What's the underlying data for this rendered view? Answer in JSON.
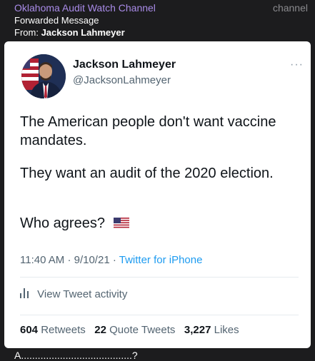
{
  "forward_header": {
    "channel_name": "Oklahoma Audit Watch Channel",
    "channel_tag": "channel",
    "forwarded_label": "Forwarded Message",
    "from_label": "From:",
    "from_name": "Jackson Lahmeyer"
  },
  "tweet": {
    "author_name": "Jackson Lahmeyer",
    "author_handle": "@JacksonLahmeyer",
    "more_glyph": "···",
    "text_line_1": "The American people don't want vaccine mandates.",
    "text_line_2": "They want an audit of the 2020 election.",
    "text_line_3": "Who agrees?",
    "time": "11:40 AM",
    "date": "9/10/21",
    "source": "Twitter for iPhone",
    "separator": "·",
    "activity_label": "View Tweet activity",
    "retweets_count": "604",
    "retweets_label": "Retweets",
    "quotes_count": "22",
    "quotes_label": "Quote Tweets",
    "likes_count": "3,227",
    "likes_label": "Likes"
  },
  "caption": "A........................................?",
  "icons": {
    "more": "more-horizontal-icon",
    "activity": "bar-chart-icon",
    "flag": "us-flag-emoji"
  },
  "colors": {
    "channel_name": "#a98be8",
    "link": "#1d9bf0",
    "secondary_text": "#536471",
    "primary_text": "#0f1419"
  }
}
